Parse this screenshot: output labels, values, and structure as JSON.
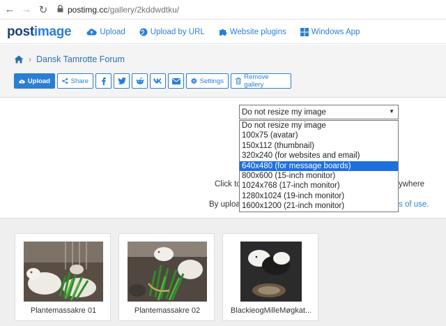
{
  "browser": {
    "host": "postimg.cc",
    "path": "/gallery/2kddwdtku/"
  },
  "site_nav": {
    "logo_part1": "post",
    "logo_part2": "image",
    "links": [
      {
        "label": "Upload",
        "icon": "cloud-upload-icon"
      },
      {
        "label": "Upload by URL",
        "icon": "globe-icon"
      },
      {
        "label": "Website plugins",
        "icon": "puzzle-icon"
      },
      {
        "label": "Windows App",
        "icon": "windows-icon"
      }
    ]
  },
  "breadcrumb": {
    "gallery_name": "Dansk Tamrotte Forum"
  },
  "toolbar": {
    "upload_label": "Upload",
    "share_label": "Share",
    "settings_label": "Settings",
    "remove_label": "Remove gallery"
  },
  "resize": {
    "selected": "Do not resize my image",
    "options": [
      "Do not resize my image",
      "100x75 (avatar)",
      "150x112 (thumbnail)",
      "320x240 (for websites and email)",
      "640x480 (for message boards)",
      "800x600 (15-inch monitor)",
      "1024x768 (17-inch monitor)",
      "1280x1024 (19-inch monitor)",
      "1600x1200 (21-inch monitor)"
    ],
    "highlighted": "640x480 (for message boards)"
  },
  "upload_area": {
    "click_text": "Click to",
    "anywhere_text": "ywhere",
    "by_text": "By uploa",
    "terms_text": "s of use."
  },
  "gallery": {
    "items": [
      {
        "caption": "Plantemassakre 01"
      },
      {
        "caption": "Plantemassakre 02"
      },
      {
        "caption": "BlackieogMilleMøgkat..."
      }
    ]
  },
  "colors": {
    "accent": "#2a7fd4",
    "logo_dark": "#1f3f7a",
    "selected_option": "#1e6fe0"
  }
}
